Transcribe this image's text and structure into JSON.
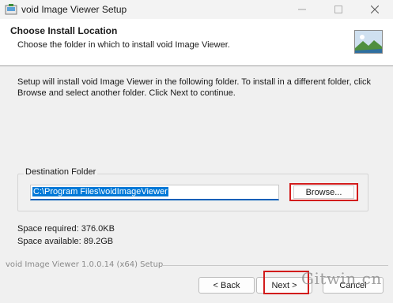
{
  "window": {
    "title": "void Image Viewer Setup",
    "icon": "installer-icon",
    "controls": {
      "minimize": "minimize-icon",
      "maximize": "maximize-icon",
      "close": "close-icon"
    }
  },
  "header": {
    "title": "Choose Install Location",
    "subtitle": "Choose the folder in which to install void Image Viewer.",
    "image": "landscape-image-icon"
  },
  "body": {
    "intro": "Setup will install void Image Viewer in the following folder. To install in a different folder, click Browse and select another folder. Click Next to continue.",
    "destination": {
      "group_label": "Destination Folder",
      "path_value": "C:\\Program Files\\voidImageViewer",
      "browse_label": "Browse..."
    },
    "space_required": "Space required: 376.0KB",
    "space_available": "Space available: 89.2GB"
  },
  "footer": {
    "branding": "void Image Viewer 1.0.0.14 (x64) Setup",
    "back_label": "< Back",
    "next_label": "Next >",
    "cancel_label": "Cancel"
  },
  "watermark": "Gitwin.cn",
  "colors": {
    "highlight_outline": "#d21c1c",
    "selection": "#0078d7",
    "field_underline": "#005fb8"
  }
}
